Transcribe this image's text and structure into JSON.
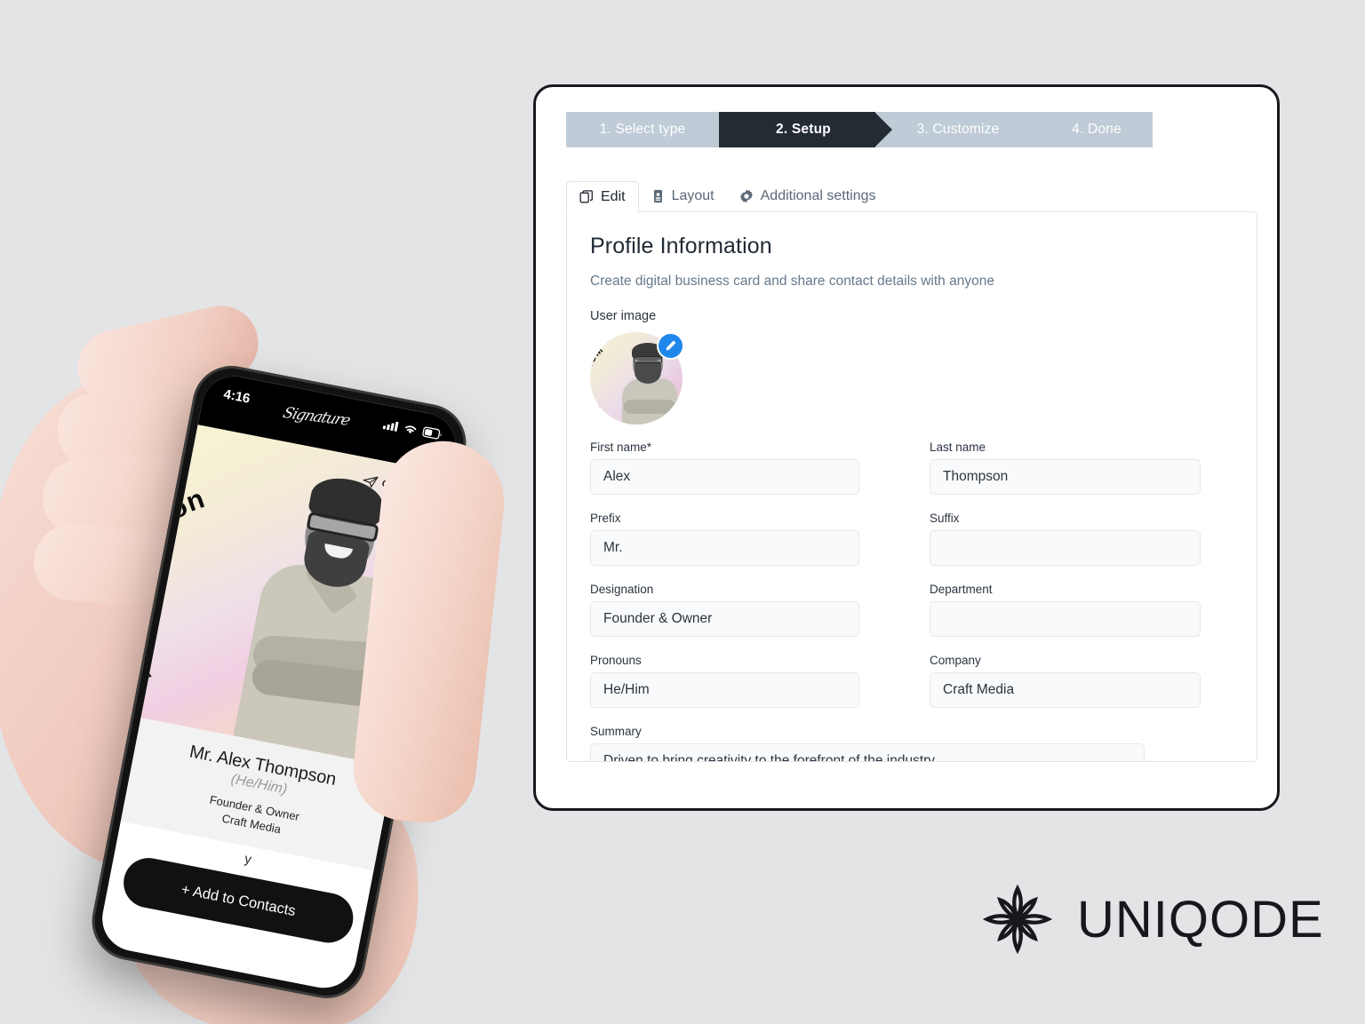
{
  "background_color": "#e3e4e6",
  "stepper": {
    "active_index": 1,
    "active_color": "#232b33",
    "inactive_color": "#bfcbd6",
    "steps": [
      {
        "label": "1. Select type"
      },
      {
        "label": "2. Setup"
      },
      {
        "label": "3. Customize"
      },
      {
        "label": "4. Done"
      }
    ]
  },
  "tabs": {
    "active_index": 0,
    "items": [
      {
        "label": "Edit",
        "icon": "copy-icon"
      },
      {
        "label": "Layout",
        "icon": "id-card-icon"
      },
      {
        "label": "Additional settings",
        "icon": "gear-icon"
      }
    ]
  },
  "panel": {
    "title": "Profile Information",
    "subtitle": "Create digital business card and share contact details with anyone",
    "user_image_label": "User image",
    "avatar": {
      "arc_text": "ALEX THOMPSON",
      "edit_badge_icon": "pencil-icon",
      "edit_badge_color": "#1f87eb"
    },
    "fields": [
      {
        "label": "First name*",
        "value": "Alex",
        "placeholder": "",
        "name": "first-name"
      },
      {
        "label": "Last name",
        "value": "Thompson",
        "placeholder": "",
        "name": "last-name"
      },
      {
        "label": "Prefix",
        "value": "Mr.",
        "placeholder": "",
        "name": "prefix"
      },
      {
        "label": "Suffix",
        "value": "",
        "placeholder": "",
        "name": "suffix"
      },
      {
        "label": "Designation",
        "value": "Founder & Owner",
        "placeholder": "",
        "name": "designation"
      },
      {
        "label": "Department",
        "value": "",
        "placeholder": "",
        "name": "department"
      },
      {
        "label": "Pronouns",
        "value": "He/Him",
        "placeholder": "",
        "name": "pronouns"
      },
      {
        "label": "Company",
        "value": "Craft Media",
        "placeholder": "",
        "name": "company"
      }
    ],
    "summary": {
      "label": "Summary",
      "value": "Driven to bring creativity to the forefront of the industry."
    }
  },
  "phone": {
    "status_bar": {
      "time": "4:16",
      "signature_script": "Signature",
      "icons": [
        "cellular-signal-icon",
        "wifi-icon",
        "battery-icon"
      ]
    },
    "card": {
      "brand": "Craft Media",
      "brand_icon": "paper-plane-icon",
      "hero_arc_text": "Alex Thompson",
      "name": "Mr. Alex Thompson",
      "pronouns": "(He/Him)",
      "designation": "Founder & Owner",
      "company": "Craft Media",
      "partial_text_left": "",
      "partial_text_right": "y",
      "cta_label": "+ Add to Contacts"
    }
  },
  "branding": {
    "wordmark": "UNIQODE",
    "mark_icon": "uniqode-flower-icon"
  }
}
